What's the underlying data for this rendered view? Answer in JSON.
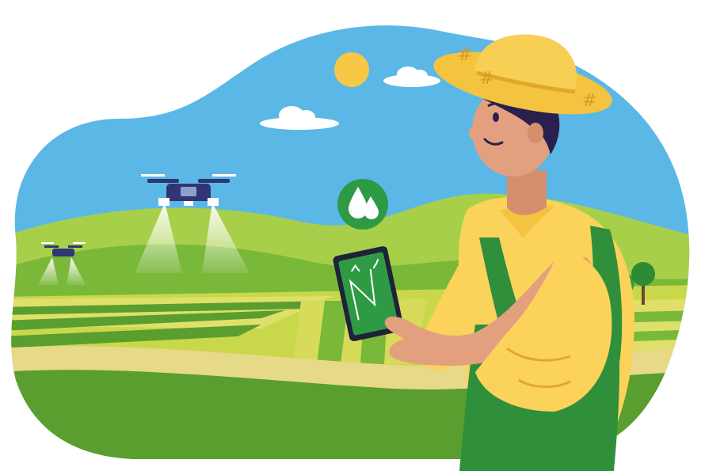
{
  "scene": {
    "subject": "farmer-with-tablet",
    "icons": [
      "sun-icon",
      "cloud-icon",
      "drone-icon",
      "water-drops-icon",
      "tablet-icon",
      "tree-icon"
    ],
    "colors": {
      "sky": "#5bb8e6",
      "hill_light": "#a8cf4a",
      "hill_dark": "#5a9e2f",
      "field_yellow": "#dfe06a",
      "field_green": "#7ab83a",
      "path": "#e6d987",
      "hat": "#f4c33f",
      "shirt": "#fbd35a",
      "overalls": "#2f8f3a",
      "skin": "#e3a07e",
      "hair": "#2b1f4d",
      "drone": "#2f3673",
      "spray": "#e9f6ff",
      "sun": "#f7c845",
      "badge": "#2f9a44"
    }
  }
}
